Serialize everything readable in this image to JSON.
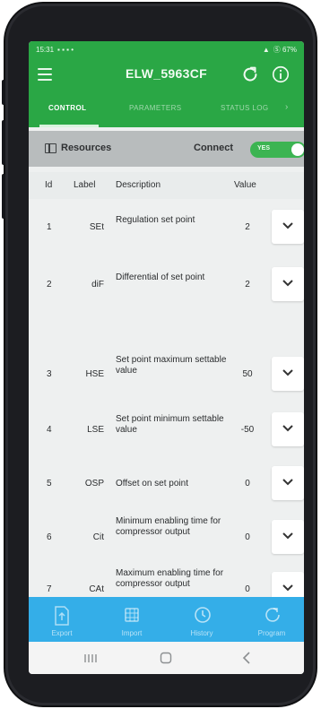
{
  "status": {
    "time": "15:31",
    "right": "Ⓢ 67%"
  },
  "app": {
    "title": "ELW_5963CF",
    "tabs": [
      {
        "label": "CONTROL",
        "active": true
      },
      {
        "label": "PARAMETERS",
        "active": false
      },
      {
        "label": "STATUS LOG",
        "active": false
      }
    ],
    "tab_more": "›"
  },
  "resources": {
    "label": "Resources",
    "connect_label": "Connect",
    "toggle_text": "YES",
    "toggle_on": true
  },
  "table": {
    "headers": {
      "id": "Id",
      "label": "Label",
      "description": "Description",
      "value": "Value"
    },
    "rows": [
      {
        "id": "1",
        "label": "SEt",
        "description": "Regulation set point",
        "value": "2"
      },
      {
        "id": "2",
        "label": "diF",
        "description": "Differential of set point",
        "value": "2"
      },
      {
        "id": "3",
        "label": "HSE",
        "description": "Set point maximum settable value",
        "value": "50"
      },
      {
        "id": "4",
        "label": "LSE",
        "description": "Set point minimum settable value",
        "value": "-50"
      },
      {
        "id": "5",
        "label": "OSP",
        "description": "Offset on set point",
        "value": "0"
      },
      {
        "id": "6",
        "label": "Cit",
        "description": "Minimum enabling time for compressor output",
        "value": "0"
      },
      {
        "id": "7",
        "label": "CAt",
        "description": "Maximum enabling time for compressor output",
        "value": "0"
      }
    ]
  },
  "bottom_nav": [
    {
      "label": "Export",
      "icon": "export-icon"
    },
    {
      "label": "Import",
      "icon": "import-icon"
    },
    {
      "label": "History",
      "icon": "history-icon"
    },
    {
      "label": "Program",
      "icon": "program-icon"
    }
  ],
  "colors": {
    "appbar": "#2aa745",
    "bottom_nav": "#34aee8",
    "toggle_on": "#3cb452"
  }
}
